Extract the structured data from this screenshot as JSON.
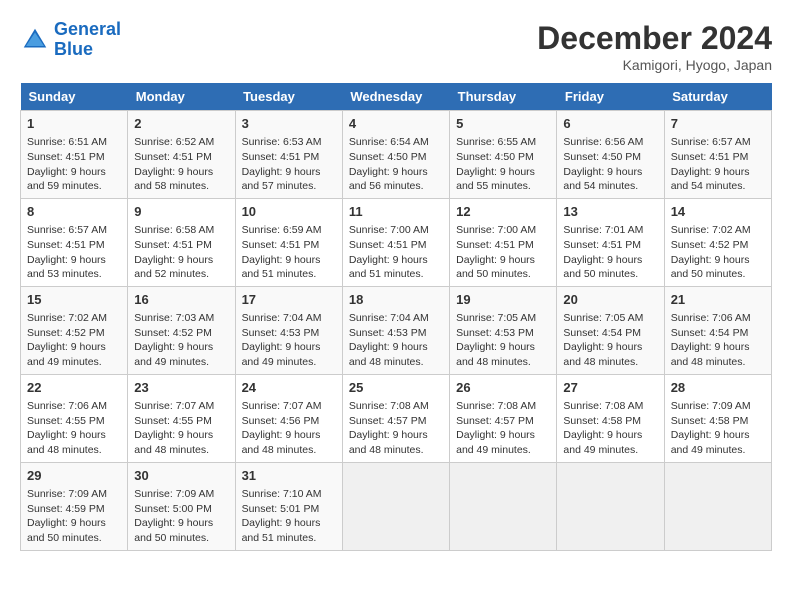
{
  "header": {
    "logo_line1": "General",
    "logo_line2": "Blue",
    "month": "December 2024",
    "location": "Kamigori, Hyogo, Japan"
  },
  "days_of_week": [
    "Sunday",
    "Monday",
    "Tuesday",
    "Wednesday",
    "Thursday",
    "Friday",
    "Saturday"
  ],
  "weeks": [
    [
      {
        "day": "1",
        "info": "Sunrise: 6:51 AM\nSunset: 4:51 PM\nDaylight: 9 hours and 59 minutes."
      },
      {
        "day": "2",
        "info": "Sunrise: 6:52 AM\nSunset: 4:51 PM\nDaylight: 9 hours and 58 minutes."
      },
      {
        "day": "3",
        "info": "Sunrise: 6:53 AM\nSunset: 4:51 PM\nDaylight: 9 hours and 57 minutes."
      },
      {
        "day": "4",
        "info": "Sunrise: 6:54 AM\nSunset: 4:50 PM\nDaylight: 9 hours and 56 minutes."
      },
      {
        "day": "5",
        "info": "Sunrise: 6:55 AM\nSunset: 4:50 PM\nDaylight: 9 hours and 55 minutes."
      },
      {
        "day": "6",
        "info": "Sunrise: 6:56 AM\nSunset: 4:50 PM\nDaylight: 9 hours and 54 minutes."
      },
      {
        "day": "7",
        "info": "Sunrise: 6:57 AM\nSunset: 4:51 PM\nDaylight: 9 hours and 54 minutes."
      }
    ],
    [
      {
        "day": "8",
        "info": "Sunrise: 6:57 AM\nSunset: 4:51 PM\nDaylight: 9 hours and 53 minutes."
      },
      {
        "day": "9",
        "info": "Sunrise: 6:58 AM\nSunset: 4:51 PM\nDaylight: 9 hours and 52 minutes."
      },
      {
        "day": "10",
        "info": "Sunrise: 6:59 AM\nSunset: 4:51 PM\nDaylight: 9 hours and 51 minutes."
      },
      {
        "day": "11",
        "info": "Sunrise: 7:00 AM\nSunset: 4:51 PM\nDaylight: 9 hours and 51 minutes."
      },
      {
        "day": "12",
        "info": "Sunrise: 7:00 AM\nSunset: 4:51 PM\nDaylight: 9 hours and 50 minutes."
      },
      {
        "day": "13",
        "info": "Sunrise: 7:01 AM\nSunset: 4:51 PM\nDaylight: 9 hours and 50 minutes."
      },
      {
        "day": "14",
        "info": "Sunrise: 7:02 AM\nSunset: 4:52 PM\nDaylight: 9 hours and 50 minutes."
      }
    ],
    [
      {
        "day": "15",
        "info": "Sunrise: 7:02 AM\nSunset: 4:52 PM\nDaylight: 9 hours and 49 minutes."
      },
      {
        "day": "16",
        "info": "Sunrise: 7:03 AM\nSunset: 4:52 PM\nDaylight: 9 hours and 49 minutes."
      },
      {
        "day": "17",
        "info": "Sunrise: 7:04 AM\nSunset: 4:53 PM\nDaylight: 9 hours and 49 minutes."
      },
      {
        "day": "18",
        "info": "Sunrise: 7:04 AM\nSunset: 4:53 PM\nDaylight: 9 hours and 48 minutes."
      },
      {
        "day": "19",
        "info": "Sunrise: 7:05 AM\nSunset: 4:53 PM\nDaylight: 9 hours and 48 minutes."
      },
      {
        "day": "20",
        "info": "Sunrise: 7:05 AM\nSunset: 4:54 PM\nDaylight: 9 hours and 48 minutes."
      },
      {
        "day": "21",
        "info": "Sunrise: 7:06 AM\nSunset: 4:54 PM\nDaylight: 9 hours and 48 minutes."
      }
    ],
    [
      {
        "day": "22",
        "info": "Sunrise: 7:06 AM\nSunset: 4:55 PM\nDaylight: 9 hours and 48 minutes."
      },
      {
        "day": "23",
        "info": "Sunrise: 7:07 AM\nSunset: 4:55 PM\nDaylight: 9 hours and 48 minutes."
      },
      {
        "day": "24",
        "info": "Sunrise: 7:07 AM\nSunset: 4:56 PM\nDaylight: 9 hours and 48 minutes."
      },
      {
        "day": "25",
        "info": "Sunrise: 7:08 AM\nSunset: 4:57 PM\nDaylight: 9 hours and 48 minutes."
      },
      {
        "day": "26",
        "info": "Sunrise: 7:08 AM\nSunset: 4:57 PM\nDaylight: 9 hours and 49 minutes."
      },
      {
        "day": "27",
        "info": "Sunrise: 7:08 AM\nSunset: 4:58 PM\nDaylight: 9 hours and 49 minutes."
      },
      {
        "day": "28",
        "info": "Sunrise: 7:09 AM\nSunset: 4:58 PM\nDaylight: 9 hours and 49 minutes."
      }
    ],
    [
      {
        "day": "29",
        "info": "Sunrise: 7:09 AM\nSunset: 4:59 PM\nDaylight: 9 hours and 50 minutes."
      },
      {
        "day": "30",
        "info": "Sunrise: 7:09 AM\nSunset: 5:00 PM\nDaylight: 9 hours and 50 minutes."
      },
      {
        "day": "31",
        "info": "Sunrise: 7:10 AM\nSunset: 5:01 PM\nDaylight: 9 hours and 51 minutes."
      },
      {
        "day": "",
        "info": ""
      },
      {
        "day": "",
        "info": ""
      },
      {
        "day": "",
        "info": ""
      },
      {
        "day": "",
        "info": ""
      }
    ]
  ]
}
